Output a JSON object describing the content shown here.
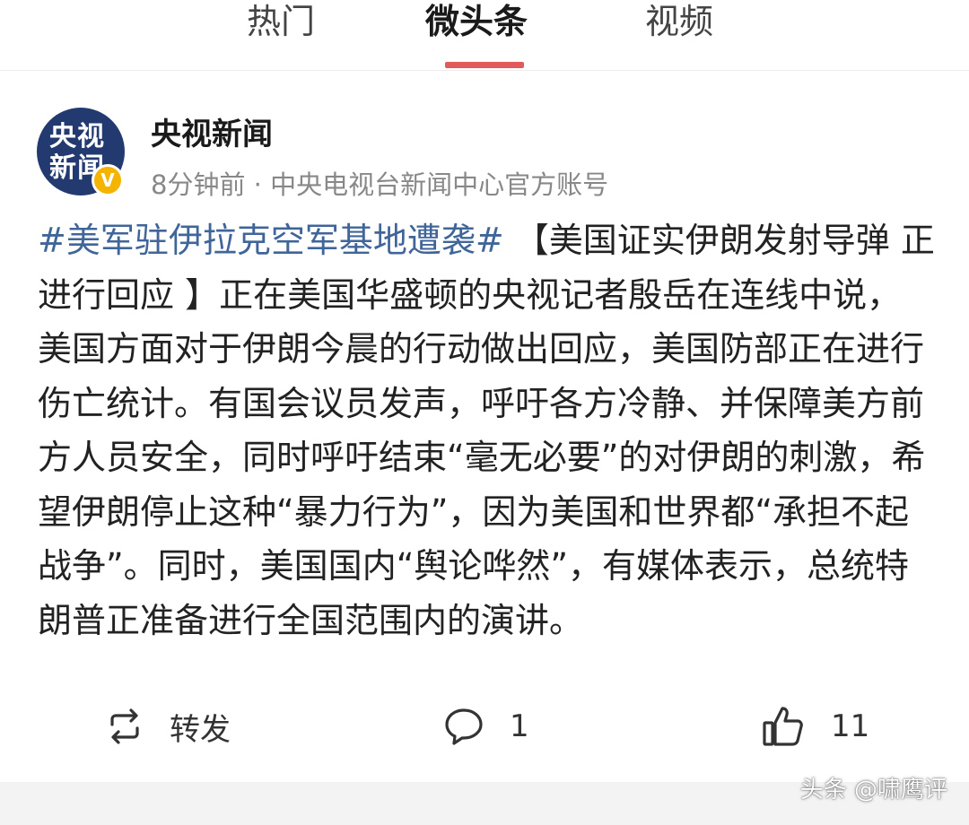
{
  "tabs": [
    {
      "label": "热门",
      "active": false
    },
    {
      "label": "微头条",
      "active": true
    },
    {
      "label": "视频",
      "active": false
    }
  ],
  "author": {
    "name": "央视新闻",
    "avatar_text": "央视新闻",
    "verified_mark": "V",
    "meta": "8分钟前 · 中央电视台新闻中心官方账号"
  },
  "post": {
    "hashtag": "#美军驻伊拉克空军基地遭袭#",
    "text": " 【美国证实伊朗发射导弹 正进行回应 】正在美国华盛顿的央视记者殷岳在连线中说，美国方面对于伊朗今晨的行动做出回应，美国防部正在进行伤亡统计。有国会议员发声，呼吁各方冷静、并保障美方前方人员安全，同时呼吁结束“毫无必要”的对伊朗的刺激，希望伊朗停止这种“暴力行为”，因为美国和世界都“承担不起战争”。同时，美国国内“舆论哗然”，有媒体表示，总统特朗普正准备进行全国范围内的演讲。"
  },
  "actions": {
    "share_label": "转发",
    "comment_count": "1",
    "like_count": "11"
  },
  "watermark": "头条 @啸鹰评",
  "colors": {
    "accent": "#e25b5b",
    "hashtag": "#406599",
    "avatar_bg": "#233a71",
    "verified": "#f4b400"
  }
}
